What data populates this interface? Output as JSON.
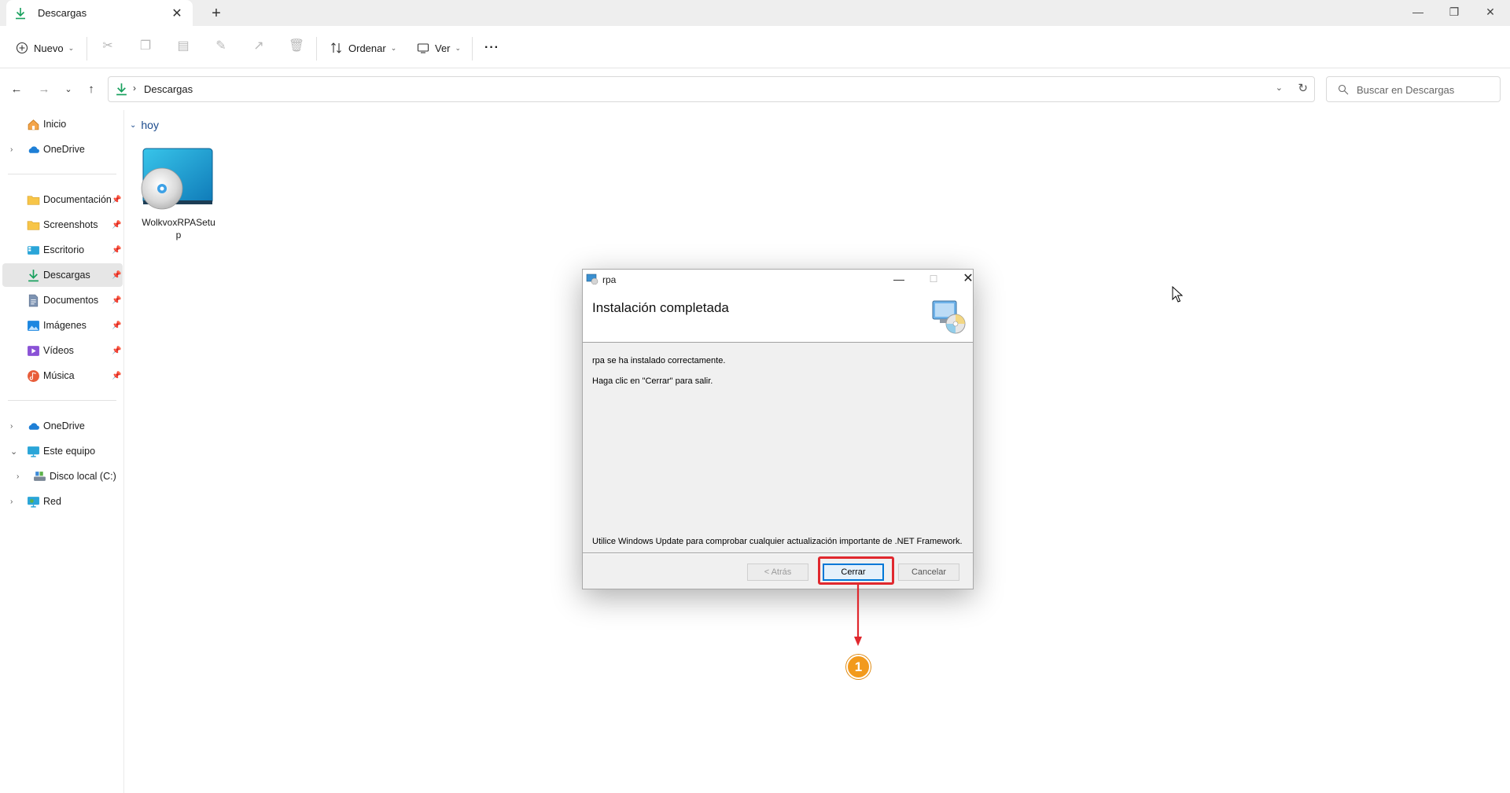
{
  "window": {
    "tab_label": "Descargas",
    "tab_close": "✕",
    "new_tab": "+",
    "minimize": "—",
    "restore": "❐",
    "close": "✕"
  },
  "toolbar": {
    "new_label": "Nuevo",
    "sort_label": "Ordenar",
    "view_label": "Ver",
    "more_label": "···"
  },
  "address": {
    "path": "Descargas",
    "search_placeholder": "Buscar en Descargas"
  },
  "sidebar": {
    "items": [
      {
        "label": "Inicio"
      },
      {
        "label": "OneDrive"
      },
      {
        "label": "Documentación"
      },
      {
        "label": "Screenshots"
      },
      {
        "label": "Escritorio"
      },
      {
        "label": "Descargas"
      },
      {
        "label": "Documentos"
      },
      {
        "label": "Imágenes"
      },
      {
        "label": "Vídeos"
      },
      {
        "label": "Música"
      },
      {
        "label": "OneDrive"
      },
      {
        "label": "Este equipo"
      },
      {
        "label": "Disco local (C:)"
      },
      {
        "label": "Red"
      }
    ]
  },
  "content": {
    "group_label": "hoy",
    "file_name": "WolkvoxRPASetup"
  },
  "dialog": {
    "title": "rpa",
    "heading": "Instalación completada",
    "line1": "rpa se ha instalado correctamente.",
    "line2": "Haga clic en \"Cerrar\" para salir.",
    "line3": "Utilice Windows Update para comprobar cualquier actualización importante de .NET Framework.",
    "back_label": "< Atrás",
    "close_label": "Cerrar",
    "cancel_label": "Cancelar"
  },
  "annotation": {
    "step_number": "1"
  },
  "colors": {
    "accent": "#0078d7",
    "highlight": "#e0282e",
    "badge": "#f29a1d",
    "download_green": "#17a05d"
  }
}
